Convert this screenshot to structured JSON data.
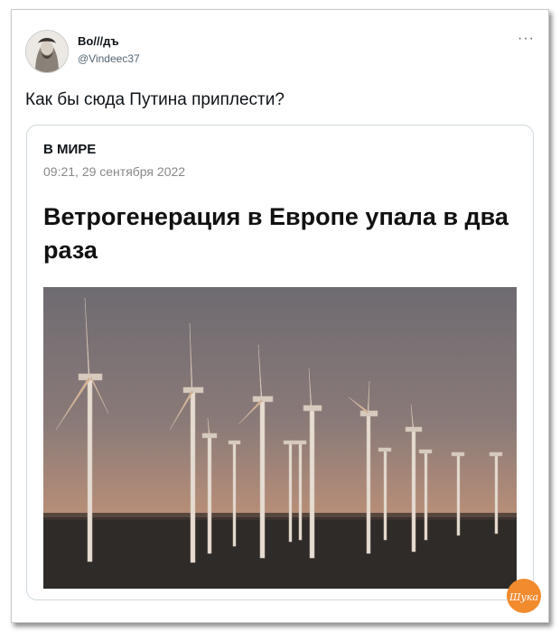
{
  "tweet": {
    "author_name": "Во///дъ",
    "author_handle": "@Vindeec37",
    "more_glyph": "···",
    "text": "Как бы сюда Путина приплести?"
  },
  "article": {
    "section": "В МИРЕ",
    "date": "09:21, 29 сентября 2022",
    "headline": "Ветрогенерация в Европе упала в два раза"
  },
  "watermark": {
    "text": "Шука"
  }
}
